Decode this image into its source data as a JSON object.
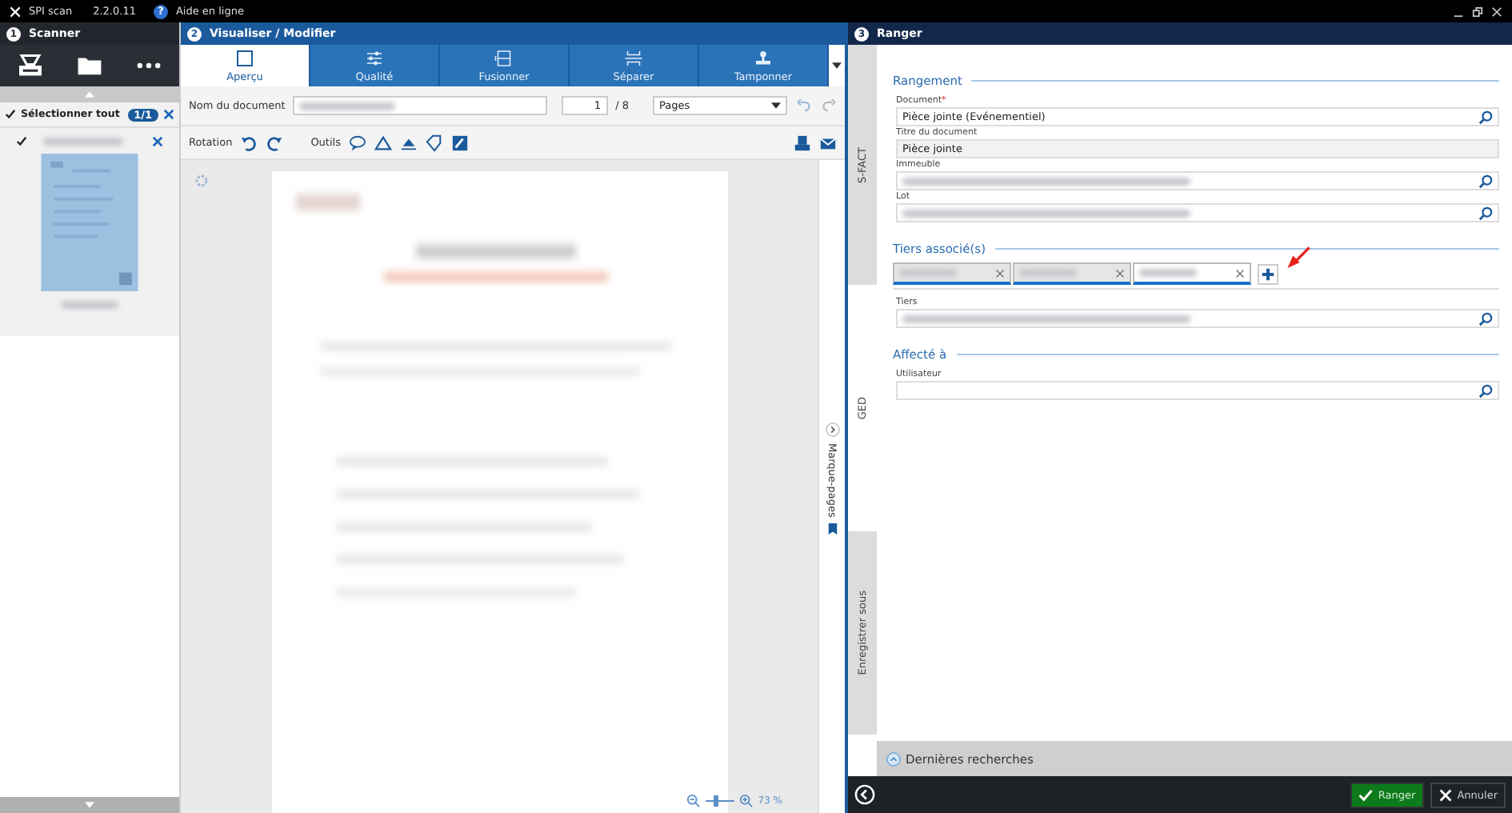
{
  "app_bar": {
    "logo": "SPI scan",
    "version": "2.2.0.11",
    "help_icon": "?",
    "help": "Aide en ligne"
  },
  "panels": [
    {
      "number": "1",
      "title": "Scanner"
    },
    {
      "number": "2",
      "title": "Visualiser / Modifier"
    },
    {
      "number": "3",
      "title": "Ranger"
    }
  ],
  "scanner": {
    "select_all": {
      "label": "Sélectionner tout",
      "checked": true,
      "count": "1/1"
    },
    "items": [
      {
        "checked": true,
        "redacted": true
      }
    ]
  },
  "viewer": {
    "tabs": [
      {
        "label": "Aperçu",
        "kind": "preview",
        "selected": true
      },
      {
        "label": "Qualité",
        "kind": "quality",
        "selected": false
      },
      {
        "label": "Fusionner",
        "kind": "merge",
        "selected": false
      },
      {
        "label": "Séparer",
        "kind": "split",
        "selected": false
      },
      {
        "label": "Tamponner",
        "kind": "stamp",
        "selected": false
      }
    ],
    "name_label": "Nom du document",
    "name_redacted": true,
    "page": "1",
    "page_total": "/ 8",
    "page_mode": "Pages",
    "rotation_label": "Rotation",
    "tools_label": "Outils",
    "bookmarks": "Marque-pages",
    "zoom": "73 %",
    "zoom_slider": {
      "level": 0.3
    }
  },
  "ranger": {
    "side_tabs": [
      {
        "label": "S-FACT",
        "selected": false
      },
      {
        "label": "GED",
        "selected": true
      },
      {
        "label": "Enregistrer sous",
        "selected": false
      }
    ],
    "sections": [
      {
        "title": "Rangement",
        "fields": [
          {
            "label": "Document",
            "required_mark": "*",
            "value": "Pièce jointe (Evénementiel)",
            "kind": "search"
          },
          {
            "label": "Titre du document",
            "value": "Pièce jointe",
            "kind": "readonly"
          },
          {
            "label": "Immeuble",
            "redacted": true,
            "kind": "search"
          },
          {
            "label": "Lot",
            "redacted": true,
            "kind": "search"
          }
        ]
      },
      {
        "title": "Tiers associé(s)",
        "chips": [
          {
            "redacted": true,
            "selected": false
          },
          {
            "redacted": true,
            "selected": false
          },
          {
            "redacted": true,
            "selected": true
          }
        ],
        "fields": [
          {
            "label": "Tiers",
            "redacted": true,
            "kind": "search"
          }
        ]
      },
      {
        "title": "Affecté à",
        "fields": [
          {
            "label": "Utilisateur",
            "kind": "search"
          }
        ]
      }
    ],
    "recent": "Dernières recherches"
  },
  "footer": {
    "buttons": [
      {
        "label": "Ranger",
        "kind": "primary"
      },
      {
        "label": "Annuler",
        "kind": "cancel"
      }
    ]
  }
}
